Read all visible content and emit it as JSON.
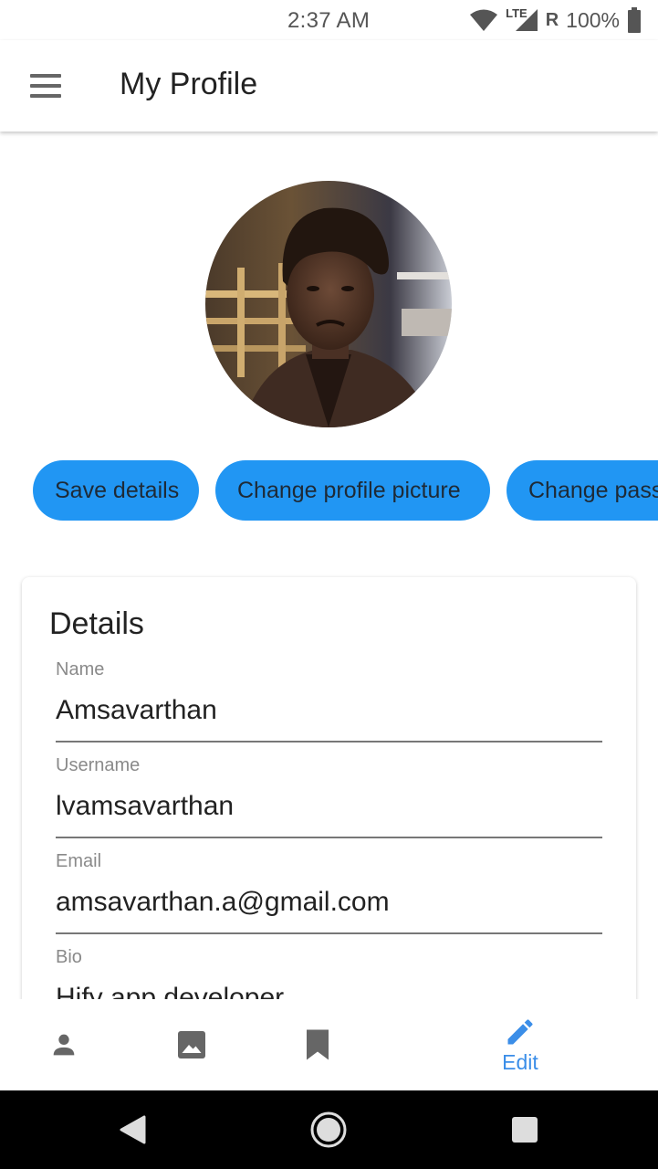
{
  "status_bar": {
    "time": "2:37 AM",
    "network": "LTE",
    "roaming": "R",
    "battery": "100%",
    "icons": [
      "wifi-icon",
      "signal-icon",
      "battery-icon"
    ]
  },
  "app_bar": {
    "title": "My Profile",
    "menu_icon": "hamburger-menu-icon"
  },
  "profile": {
    "avatar": "profile-photo"
  },
  "actions": {
    "save_label": "Save details",
    "change_picture_label": "Change profile picture",
    "change_password_label": "Change pass"
  },
  "details": {
    "title": "Details",
    "fields": [
      {
        "label": "Name",
        "value": "Amsavarthan"
      },
      {
        "label": "Username",
        "value": "lvamsavarthan"
      },
      {
        "label": "Email",
        "value": "amsavarthan.a@gmail.com"
      },
      {
        "label": "Bio",
        "value": "Hify app developer"
      }
    ]
  },
  "bottom_nav": {
    "items": [
      {
        "icon": "person-icon"
      },
      {
        "icon": "image-icon"
      },
      {
        "icon": "bookmark-icon"
      },
      {
        "icon": "edit-pencil-icon",
        "label": "Edit",
        "active": true
      }
    ]
  },
  "colors": {
    "accent": "#2196f3",
    "active_nav": "#3b8ee8",
    "icon_gray": "#666666"
  }
}
